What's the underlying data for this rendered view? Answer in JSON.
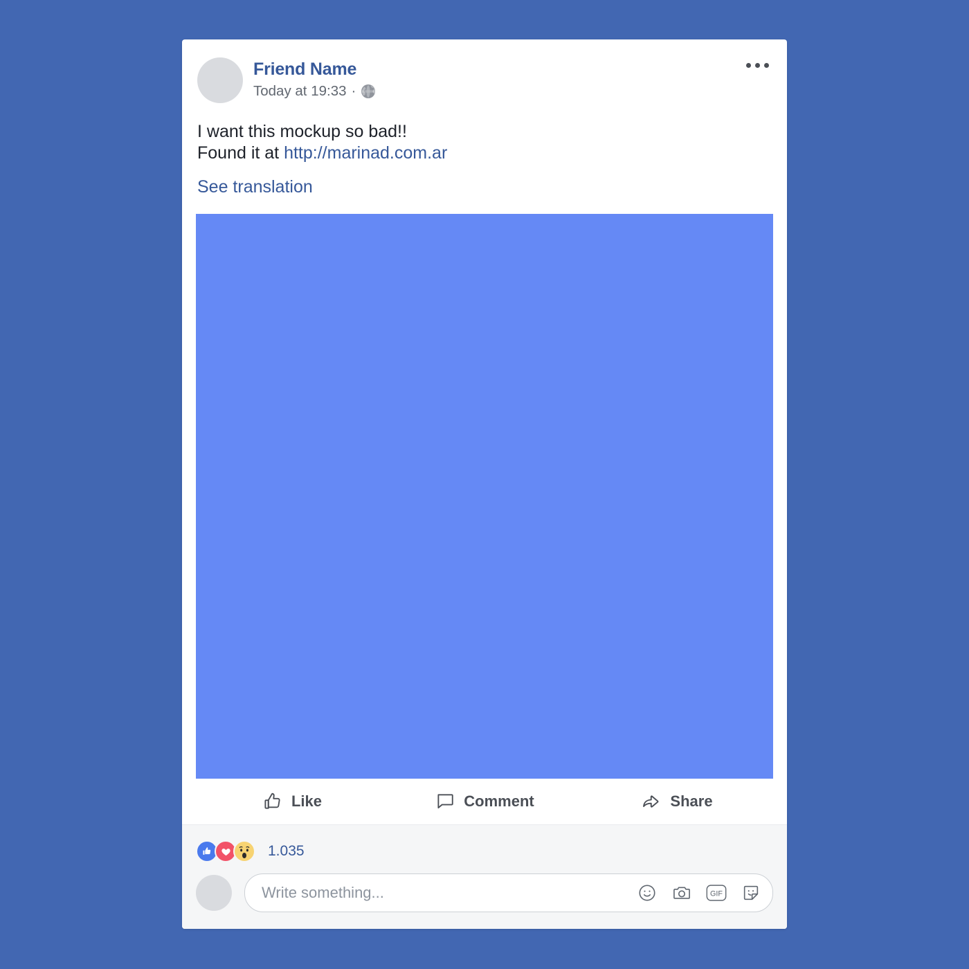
{
  "post": {
    "author": "Friend Name",
    "timestamp": "Today at 19:33",
    "meta_separator": "·",
    "privacy_icon": "globe-icon",
    "more_icon": "ellipsis-icon",
    "message_line1": "I want this mockup so bad!!",
    "message_line2_prefix": "Found it at ",
    "link_text": "http://marinad.com.ar",
    "see_translation": "See translation",
    "attachment_icon": "image-placeholder"
  },
  "actions": [
    {
      "label": "Like",
      "icon": "thumbs-up-icon"
    },
    {
      "label": "Comment",
      "icon": "comment-bubble-icon"
    },
    {
      "label": "Share",
      "icon": "share-arrow-icon"
    }
  ],
  "reactions": {
    "count": "1.035",
    "badges": [
      {
        "name": "like",
        "icon": "thumbs-up-icon"
      },
      {
        "name": "love",
        "icon": "heart-icon"
      },
      {
        "name": "wow",
        "icon": "wow-face-icon"
      }
    ]
  },
  "composer": {
    "placeholder": "Write something...",
    "value": "",
    "avatar_icon": "user-avatar",
    "icons": [
      {
        "name": "emoji-icon"
      },
      {
        "name": "camera-icon"
      },
      {
        "name": "gif-icon",
        "label": "GIF"
      },
      {
        "name": "sticker-icon"
      }
    ]
  },
  "colors": {
    "page_background": "#4267b2",
    "card_background": "#ffffff",
    "footer_background": "#f5f6f7",
    "brand_blue": "#365899",
    "attachment_blue": "#6589f5",
    "reaction_like": "#4a7aed",
    "reaction_love": "#f25268",
    "reaction_wow": "#f7d372"
  }
}
